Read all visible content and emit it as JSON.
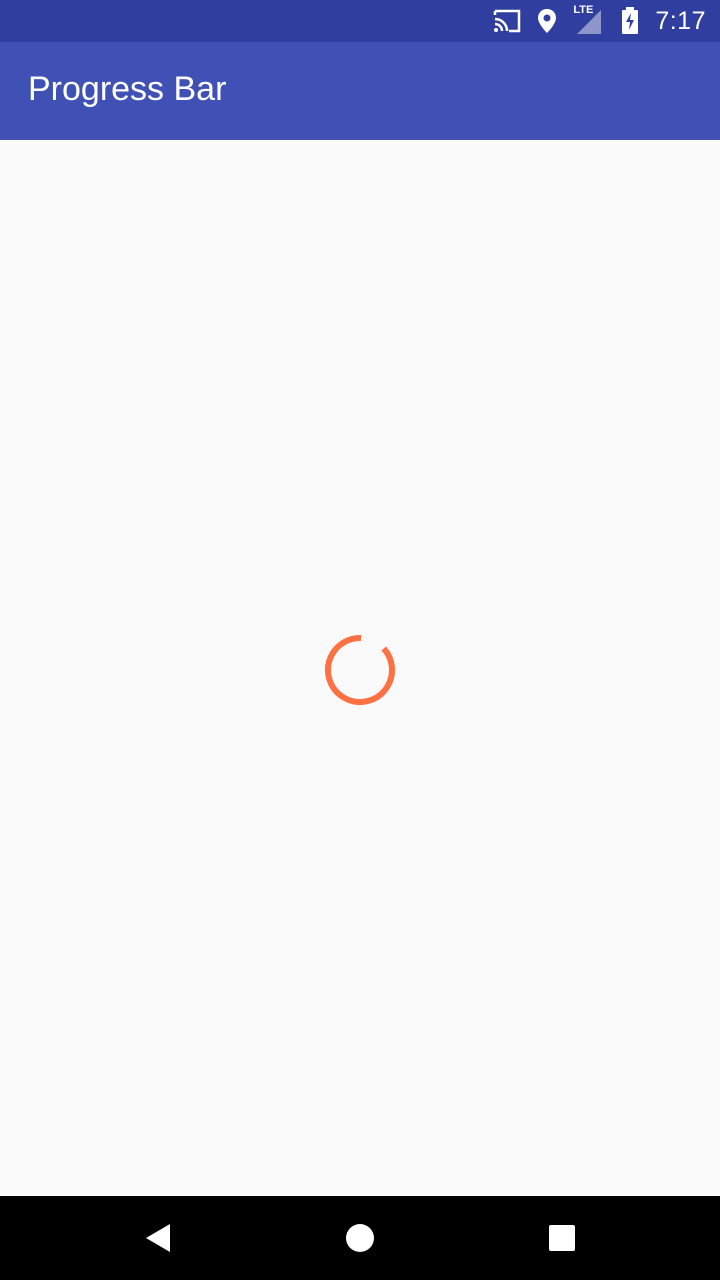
{
  "status_bar": {
    "time": "7:17",
    "network_label": "LTE",
    "icons": [
      "cast-icon",
      "location-icon",
      "signal-icon",
      "battery-charging-icon"
    ]
  },
  "app_bar": {
    "title": "Progress Bar"
  },
  "progress": {
    "type": "indeterminate-circular",
    "color": "#ff7043"
  },
  "nav_bar": {
    "icons": [
      "back-icon",
      "home-icon",
      "recents-icon"
    ]
  },
  "colors": {
    "primary": "#3f51b5",
    "primary_dark": "#303f9f",
    "accent": "#ff7043",
    "background": "#fafafa"
  }
}
